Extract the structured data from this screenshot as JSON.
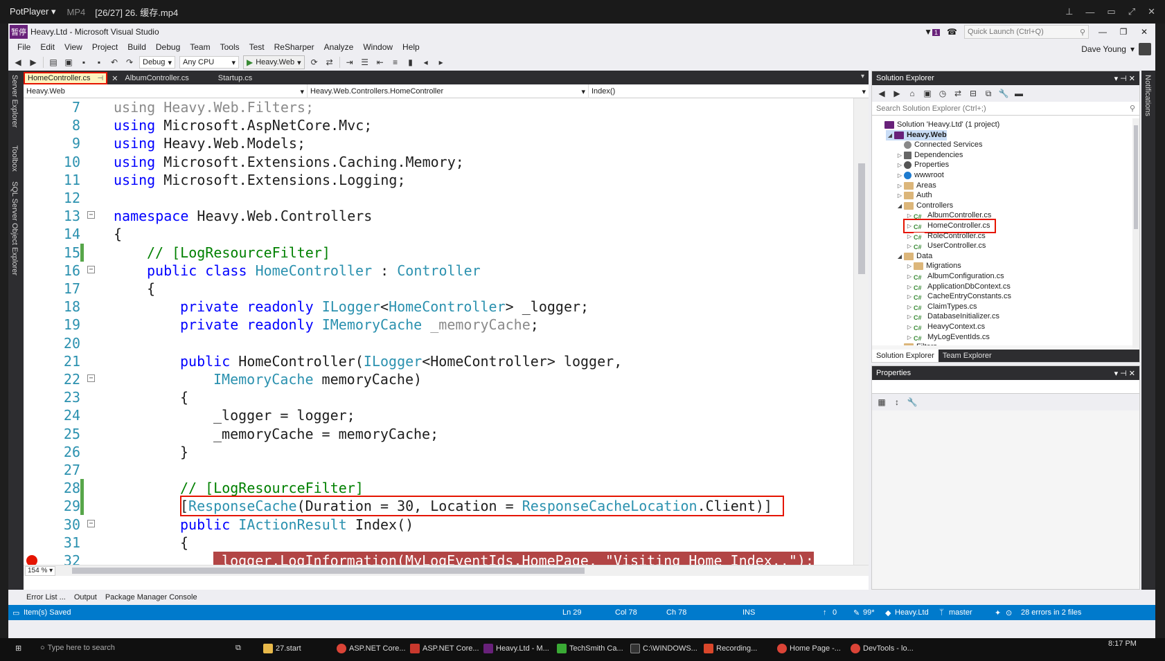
{
  "potplayer": {
    "app": "PotPlayer ▾",
    "format": "MP4",
    "file": "[26/27] 26. 缓存.mp4"
  },
  "vs": {
    "logo_text": "暂停",
    "title": "Heavy.Ltd - Microsoft Visual Studio",
    "quick_launch_placeholder": "Quick Launch (Ctrl+Q)",
    "notif_count": "1",
    "user": "Dave Young",
    "menu": [
      "File",
      "Edit",
      "View",
      "Project",
      "Build",
      "Debug",
      "Team",
      "Tools",
      "Test",
      "ReSharper",
      "Analyze",
      "Window",
      "Help"
    ],
    "toolbar": {
      "config": "Debug",
      "platform": "Any CPU",
      "run_target": "Heavy.Web"
    },
    "left_tabs": [
      "Server Explorer",
      "Toolbox",
      "SQL Server Object Explorer"
    ],
    "right_tab": "Notifications"
  },
  "editor": {
    "tabs": [
      {
        "label": "HomeController.cs",
        "active": true
      },
      {
        "label": "AlbumController.cs",
        "active": false
      },
      {
        "label": "Startup.cs",
        "active": false
      }
    ],
    "nav": {
      "project": "Heavy.Web",
      "type": "Heavy.Web.Controllers.HomeController",
      "member": "Index()"
    },
    "zoom": "154 %",
    "lines": [
      {
        "n": "7",
        "text": "using Heavy.Web.Filters;"
      },
      {
        "n": "8",
        "text": "using Microsoft.AspNetCore.Mvc;"
      },
      {
        "n": "9",
        "text": "using Heavy.Web.Models;"
      },
      {
        "n": "10",
        "text": "using Microsoft.Extensions.Caching.Memory;"
      },
      {
        "n": "11",
        "text": "using Microsoft.Extensions.Logging;"
      },
      {
        "n": "12",
        "text": ""
      },
      {
        "n": "13",
        "text": "namespace Heavy.Web.Controllers"
      },
      {
        "n": "14",
        "text": "{"
      },
      {
        "n": "15",
        "text": "// [LogResourceFilter]"
      },
      {
        "n": "16",
        "text": "public class HomeController : Controller"
      },
      {
        "n": "17",
        "text": "{"
      },
      {
        "n": "18",
        "text": "private readonly ILogger<HomeController> _logger;"
      },
      {
        "n": "19",
        "text": "private readonly IMemoryCache _memoryCache;"
      },
      {
        "n": "20",
        "text": ""
      },
      {
        "n": "21",
        "text": "public HomeController(ILogger<HomeController> logger,"
      },
      {
        "n": "22",
        "text": "IMemoryCache memoryCache)"
      },
      {
        "n": "23",
        "text": "{"
      },
      {
        "n": "24",
        "text": "_logger = logger;"
      },
      {
        "n": "25",
        "text": "_memoryCache = memoryCache;"
      },
      {
        "n": "26",
        "text": "}"
      },
      {
        "n": "27",
        "text": ""
      },
      {
        "n": "28",
        "text": "// [LogResourceFilter]"
      },
      {
        "n": "29",
        "text": "[ResponseCache(Duration = 30, Location = ResponseCacheLocation.Client)]"
      },
      {
        "n": "30",
        "text": "public IActionResult Index()"
      },
      {
        "n": "31",
        "text": "{"
      },
      {
        "n": "32",
        "text": "_logger.LogInformation(MyLogEventIds.HomePage, \"Visiting Home Index..\");"
      }
    ]
  },
  "bottom_tabs": [
    "Error List ...",
    "Output",
    "Package Manager Console"
  ],
  "solution_explorer": {
    "title": "Solution Explorer",
    "search_placeholder": "Search Solution Explorer (Ctrl+;)",
    "items": [
      {
        "label": "Solution 'Heavy.Ltd' (1 project)",
        "icon": "solution-icon"
      },
      {
        "label": "Heavy.Web",
        "icon": "project-icon"
      },
      {
        "label": "Connected Services",
        "icon": "connected-services-icon"
      },
      {
        "label": "Dependencies",
        "icon": "dependencies-icon"
      },
      {
        "label": "Properties",
        "icon": "wrench-icon"
      },
      {
        "label": "wwwroot",
        "icon": "globe-icon"
      },
      {
        "label": "Areas",
        "icon": "folder-icon"
      },
      {
        "label": "Auth",
        "icon": "folder-icon"
      },
      {
        "label": "Controllers",
        "icon": "folder-icon"
      },
      {
        "label": "AlbumController.cs",
        "icon": "csharp-file-icon"
      },
      {
        "label": "HomeController.cs",
        "icon": "csharp-file-icon"
      },
      {
        "label": "RoleController.cs",
        "icon": "csharp-file-icon"
      },
      {
        "label": "UserController.cs",
        "icon": "csharp-file-icon"
      },
      {
        "label": "Data",
        "icon": "folder-icon"
      },
      {
        "label": "Migrations",
        "icon": "folder-icon"
      },
      {
        "label": "AlbumConfiguration.cs",
        "icon": "csharp-file-icon"
      },
      {
        "label": "ApplicationDbContext.cs",
        "icon": "csharp-file-icon"
      },
      {
        "label": "CacheEntryConstants.cs",
        "icon": "csharp-file-icon"
      },
      {
        "label": "ClaimTypes.cs",
        "icon": "csharp-file-icon"
      },
      {
        "label": "DatabaseInitializer.cs",
        "icon": "csharp-file-icon"
      },
      {
        "label": "HeavyContext.cs",
        "icon": "csharp-file-icon"
      },
      {
        "label": "MyLogEventIds.cs",
        "icon": "csharp-file-icon"
      },
      {
        "label": "Filters",
        "icon": "folder-icon"
      }
    ],
    "footer_tabs": [
      "Solution Explorer",
      "Team Explorer"
    ]
  },
  "properties": {
    "title": "Properties"
  },
  "status": {
    "message": "Item(s) Saved",
    "ln": "Ln 29",
    "col": "Col 78",
    "ch": "Ch 78",
    "mode": "INS",
    "push": "0",
    "pencil": "99*",
    "repo": "Heavy.Ltd",
    "branch": "master",
    "errors": "28 errors in 2 files"
  },
  "taskbar": {
    "search_placeholder": "Type here to search",
    "apps": [
      "27.start",
      "ASP.NET Core...",
      "ASP.NET Core...",
      "Heavy.Ltd - M...",
      "TechSmith Ca...",
      "C:\\WINDOWS...",
      "Recording...",
      "Home Page -...",
      "DevTools - lo..."
    ],
    "time": "8:17 PM"
  },
  "colors": {
    "accent": "#007acc",
    "highlight": "#e51400",
    "breakpoint_bg": "#b24545"
  }
}
